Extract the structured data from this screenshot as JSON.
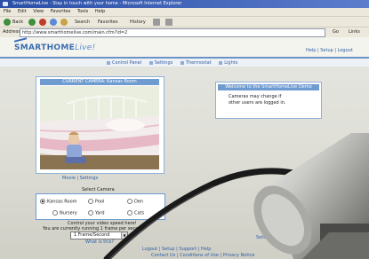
{
  "browser": {
    "title": "SmartHomeLive - Stay in touch with your home - Microsoft Internet Explorer",
    "menu": [
      "File",
      "Edit",
      "View",
      "Favorites",
      "Tools",
      "Help"
    ],
    "toolbar": {
      "back": "Back",
      "search": "Search",
      "favorites": "Favorites",
      "history": "History"
    },
    "address_label": "Address",
    "address": "http://www.smarthomelive.com/main.cfm?id=2",
    "go": "Go",
    "links": "Links"
  },
  "header": {
    "logo_main": "SMARTHOME",
    "logo_live": "Live!",
    "links": "Help | Setup | Logout"
  },
  "nav": {
    "items": [
      "Control Panel",
      "Settings",
      "Thermostat",
      "Lights"
    ]
  },
  "camera": {
    "title": "CURRENT CAMERA: Kansas Room",
    "links": "Movie | Settings"
  },
  "welcome": {
    "heading": "Welcome to the SmartHomeLive Demo",
    "line1": "Cameras may change if",
    "line2": "other users are logged in."
  },
  "select": {
    "label": "Select Camera",
    "options": [
      "Kansas Room",
      "Pool",
      "Den",
      "Nursery",
      "Yard",
      "Cats"
    ],
    "selected": "Kansas Room"
  },
  "speed": {
    "line1": "Control your video speed here!",
    "line2": "You are currently running 1 frame per second",
    "value": "1 Frame/Second",
    "whatis": "What is this?"
  },
  "setup_link": "Setup This Room",
  "footer": {
    "line1": "Logout | Setup | Support | Help",
    "line2": "Contact Us | Conditions of Use | Privacy Notice"
  }
}
